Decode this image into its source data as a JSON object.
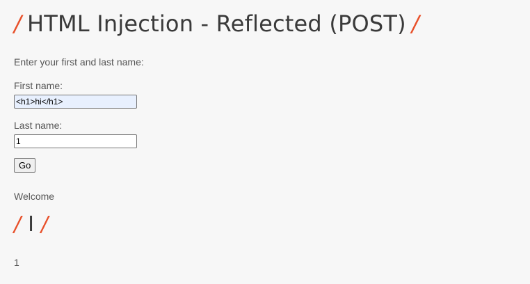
{
  "header": {
    "slash_left": "/",
    "title": "HTML Injection - Reflected (POST)",
    "slash_right": "/"
  },
  "form": {
    "intro": "Enter your first and last name:",
    "first_name_label": "First name:",
    "first_name_value": "<h1>hi</h1>",
    "last_name_label": "Last name:",
    "last_name_value": "1",
    "go_label": "Go"
  },
  "result": {
    "welcome": "Welcome",
    "slash_left": "/",
    "heading_text": "I",
    "slash_right": "/",
    "last_name_output": "1"
  },
  "colors": {
    "accent": "#e8502a",
    "text": "#555555",
    "heading": "#3a3a3a",
    "background": "#f7f7f7",
    "autofill": "#e8f0fe"
  }
}
